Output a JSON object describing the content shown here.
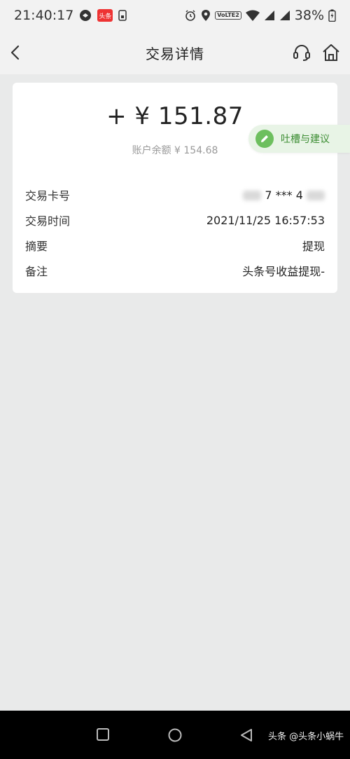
{
  "status_bar": {
    "time": "21:40:17",
    "app_badge": "头条",
    "battery": "38%",
    "network_badge": "VoLTE2"
  },
  "header": {
    "title": "交易详情",
    "icons": [
      "back-arrow-icon",
      "headset-icon",
      "home-icon"
    ]
  },
  "transaction": {
    "amount": "+ ¥ 151.87",
    "balance": "账户余额 ¥ 154.68",
    "rows": [
      {
        "label": "交易卡号",
        "value_visible": "7 *** 4"
      },
      {
        "label": "交易时间",
        "value": "2021/11/25 16:57:53"
      },
      {
        "label": "摘要",
        "value": "提现"
      },
      {
        "label": "备注",
        "value": "头条号收益提现-"
      }
    ]
  },
  "feedback": {
    "label": "吐槽与建议",
    "icon": "pencil-icon",
    "accent": "#6dbf5e"
  },
  "nav_bar": {
    "watermark": "头条 @头条小蜗牛"
  },
  "colors": {
    "background": "#e9eaea",
    "card": "#ffffff",
    "header": "#f2f2f2"
  }
}
